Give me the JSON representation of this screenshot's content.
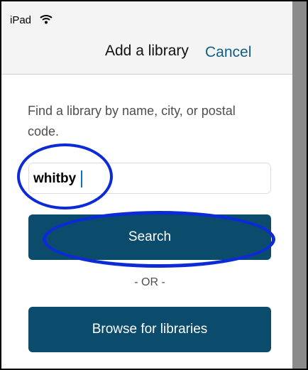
{
  "status_bar": {
    "device": "iPad",
    "signal_icon": "wifi-icon"
  },
  "nav": {
    "title": "Add a library",
    "cancel_label": "Cancel"
  },
  "form": {
    "instructions": "Find a library by name, city, or postal code.",
    "search_value": "whitby",
    "search_label": "Search",
    "or_label": "- OR -",
    "browse_label": "Browse for libraries"
  },
  "colors": {
    "accent": "#0F5F82",
    "button": "#0B4B6B",
    "highlight": "#0C2BD6",
    "dim_overlay": "#8B8B8B"
  }
}
